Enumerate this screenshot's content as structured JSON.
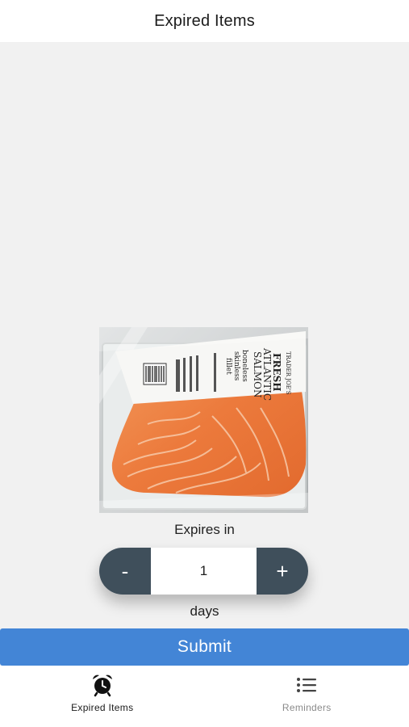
{
  "header": {
    "title": "Expired Items"
  },
  "product": {
    "image_label_lines": [
      "TRADER JOE'S",
      "FRESH",
      "ATLANTIC",
      "SALMON",
      "boneless",
      "skinless",
      "fillet"
    ]
  },
  "expiry": {
    "label": "Expires in",
    "decrement_label": "-",
    "value": "1",
    "increment_label": "+",
    "unit": "days"
  },
  "actions": {
    "submit_label": "Submit"
  },
  "tabbar": {
    "tabs": [
      {
        "label": "Expired Items",
        "icon": "alarm-clock-icon",
        "active": true
      },
      {
        "label": "Reminders",
        "icon": "list-icon",
        "active": false
      }
    ]
  },
  "colors": {
    "accent": "#4385d6",
    "stepper": "#3f4f5b",
    "background": "#f1f1f1"
  }
}
